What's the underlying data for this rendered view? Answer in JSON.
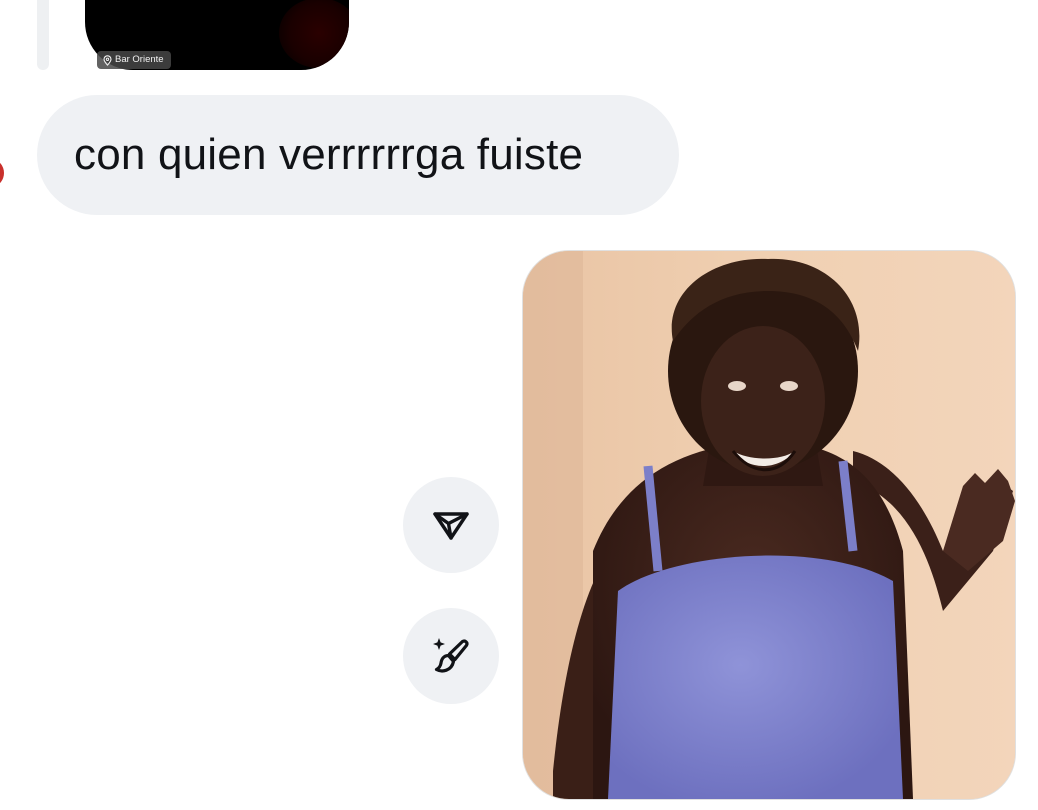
{
  "story_reply": {
    "location_label": "Bar Oriente",
    "icons": {
      "location": "location-pin-icon"
    }
  },
  "incoming_message": {
    "text": "con quien verrrrrrga fuiste"
  },
  "actions": {
    "share": {
      "icon": "send-arrow-icon"
    },
    "edit": {
      "icon": "sparkle-brush-icon"
    }
  },
  "colors": {
    "bubble_background": "#eff1f4",
    "text_primary": "#111317",
    "icon_stroke": "#111317",
    "page_background": "#ffffff"
  }
}
